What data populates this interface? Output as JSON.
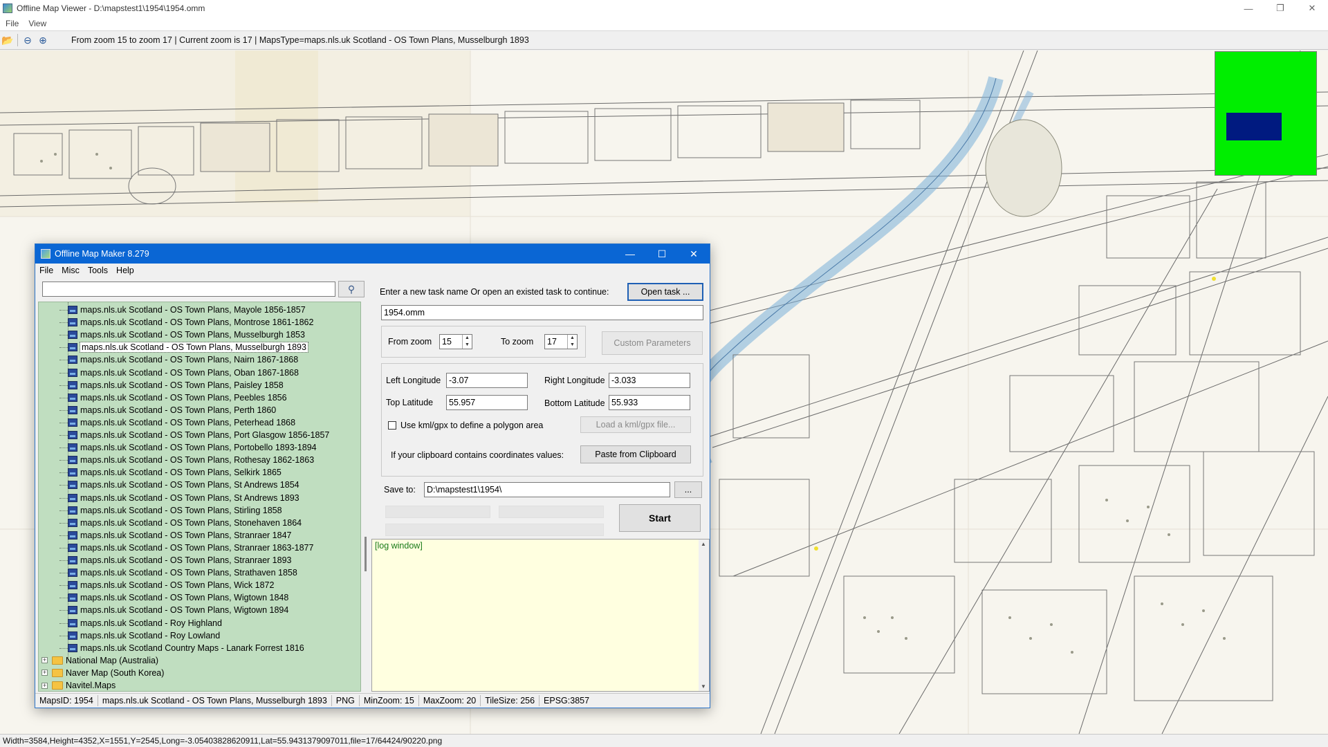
{
  "viewer": {
    "title": "Offline Map Viewer - D:\\mapstest1\\1954\\1954.omm",
    "menu": [
      "File",
      "View"
    ],
    "toolbar": {
      "info": "From zoom 15 to zoom 17   |   Current zoom is 17  |   MapsType=maps.nls.uk Scotland - OS Town Plans, Musselburgh 1893"
    },
    "minimap": {
      "background": "#00ee00",
      "viewport_color": "#001a80"
    },
    "status": "Width=3584,Height=4352,X=1551,Y=2545,Long=-3.05403828620911,Lat=55.9431379097011,file=17/64424/90220.png"
  },
  "maker": {
    "title": "Offline Map Maker 8.279",
    "menu": [
      "File",
      "Misc",
      "Tools",
      "Help"
    ],
    "search": {
      "value": "",
      "placeholder": ""
    },
    "tree": {
      "maps": [
        "maps.nls.uk Scotland - OS Town Plans, Mayole 1856-1857",
        "maps.nls.uk Scotland - OS Town Plans, Montrose 1861-1862",
        "maps.nls.uk Scotland - OS Town Plans, Musselburgh 1853",
        "maps.nls.uk Scotland - OS Town Plans, Musselburgh 1893",
        "maps.nls.uk Scotland - OS Town Plans, Nairn 1867-1868",
        "maps.nls.uk Scotland - OS Town Plans, Oban 1867-1868",
        "maps.nls.uk Scotland - OS Town Plans, Paisley 1858",
        "maps.nls.uk Scotland - OS Town Plans, Peebles 1856",
        "maps.nls.uk Scotland - OS Town Plans, Perth 1860",
        "maps.nls.uk Scotland - OS Town Plans, Peterhead 1868",
        "maps.nls.uk Scotland - OS Town Plans, Port Glasgow 1856-1857",
        "maps.nls.uk Scotland - OS Town Plans, Portobello 1893-1894",
        "maps.nls.uk Scotland - OS Town Plans, Rothesay 1862-1863",
        "maps.nls.uk Scotland - OS Town Plans, Selkirk 1865",
        "maps.nls.uk Scotland - OS Town Plans, St Andrews 1854",
        "maps.nls.uk Scotland - OS Town Plans, St Andrews 1893",
        "maps.nls.uk Scotland - OS Town Plans, Stirling 1858",
        "maps.nls.uk Scotland - OS Town Plans, Stonehaven 1864",
        "maps.nls.uk Scotland - OS Town Plans, Stranraer 1847",
        "maps.nls.uk Scotland - OS Town Plans, Stranraer 1863-1877",
        "maps.nls.uk Scotland - OS Town Plans, Stranraer 1893",
        "maps.nls.uk Scotland - OS Town Plans, Strathaven 1858",
        "maps.nls.uk Scotland - OS Town Plans, Wick 1872",
        "maps.nls.uk Scotland - OS Town Plans, Wigtown 1848",
        "maps.nls.uk Scotland - OS Town Plans, Wigtown 1894",
        "maps.nls.uk Scotland - Roy Highland",
        "maps.nls.uk Scotland - Roy Lowland",
        "maps.nls.uk Scotland Country Maps - Lanark Forrest 1816"
      ],
      "selected": "maps.nls.uk Scotland - OS Town Plans, Musselburgh 1893",
      "folders": [
        "National Map (Australia)",
        "Naver Map (South Korea)",
        "Navitel.Maps"
      ]
    },
    "task": {
      "prompt": "Enter a new task name Or open an existed task to continue:",
      "open_button": "Open task ...",
      "name": "1954.omm"
    },
    "zoom": {
      "from_label": "From zoom",
      "from_value": "15",
      "to_label": "To zoom",
      "to_value": "17",
      "custom_button": "Custom Parameters"
    },
    "coords": {
      "left_lon_label": "Left Longitude",
      "left_lon": "-3.07",
      "right_lon_label": "Right Longitude",
      "right_lon": "-3.033",
      "top_lat_label": "Top Latitude",
      "top_lat": "55.957",
      "bottom_lat_label": "Bottom Latitude",
      "bottom_lat": "55.933",
      "kml_checkbox_label": "Use kml/gpx to define a polygon area",
      "kml_checked": false,
      "kml_button": "Load a kml/gpx file...",
      "clipboard_label": "If your clipboard contains coordinates values:",
      "clipboard_button": "Paste from Clipboard"
    },
    "save": {
      "label": "Save to:",
      "path": "D:\\mapstest1\\1954\\",
      "browse_button": "..."
    },
    "start_button": "Start",
    "log": "[log window]",
    "status": {
      "maps_id": "MapsID: 1954",
      "map_name": "maps.nls.uk Scotland - OS Town Plans, Musselburgh 1893",
      "format": "PNG",
      "min_zoom": "MinZoom: 15",
      "max_zoom": "MaxZoom: 20",
      "tile_size": "TileSize: 256",
      "epsg": "EPSG:3857"
    }
  }
}
